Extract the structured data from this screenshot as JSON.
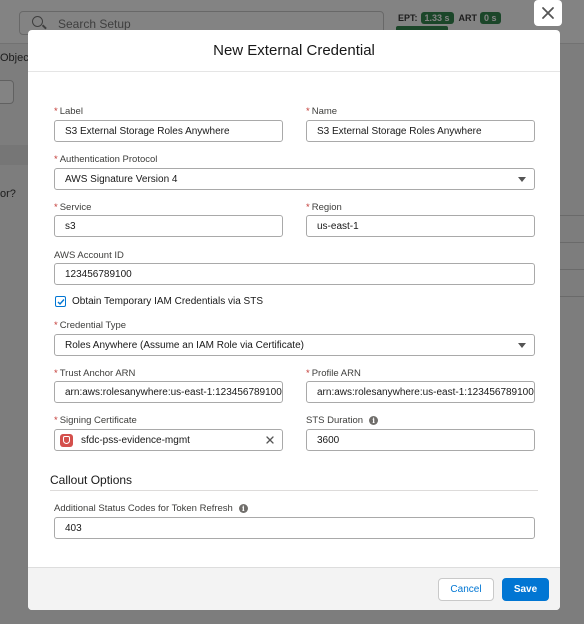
{
  "background": {
    "search_placeholder": "Search Setup",
    "ept_label": "EPT:",
    "ept_value": "1.33 s",
    "art_label": "ART",
    "art_value": "0 s",
    "objects_fragment": "Object",
    "or_fragment": "or?"
  },
  "modal": {
    "title": "New External Credential",
    "fields": {
      "label": {
        "label": "Label",
        "value": "S3 External Storage Roles Anywhere"
      },
      "name": {
        "label": "Name",
        "value": "S3 External Storage Roles Anywhere"
      },
      "auth_protocol": {
        "label": "Authentication Protocol",
        "value": "AWS Signature Version 4"
      },
      "service": {
        "label": "Service",
        "value": "s3"
      },
      "region": {
        "label": "Region",
        "value": "us-east-1"
      },
      "account_id": {
        "label": "AWS Account ID",
        "value": "123456789100"
      },
      "sts_checkbox": {
        "label": "Obtain Temporary IAM Credentials via STS",
        "checked": true
      },
      "credential_type": {
        "label": "Credential Type",
        "value": "Roles Anywhere (Assume an IAM Role via Certificate)"
      },
      "trust_anchor": {
        "label": "Trust Anchor ARN",
        "value": "arn:aws:rolesanywhere:us-east-1:123456789100"
      },
      "profile_arn": {
        "label": "Profile ARN",
        "value": "arn:aws:rolesanywhere:us-east-1:123456789100"
      },
      "signing_cert": {
        "label": "Signing Certificate",
        "value": "sfdc-pss-evidence-mgmt"
      },
      "sts_duration": {
        "label": "STS Duration",
        "value": "3600"
      }
    },
    "callout_section": {
      "title": "Callout Options",
      "status_codes": {
        "label": "Additional Status Codes for Token Refresh",
        "value": "403"
      }
    },
    "footer": {
      "cancel_label": "Cancel",
      "save_label": "Save"
    }
  },
  "colors": {
    "brand": "#0176d3",
    "required": "#c23934",
    "badge_green": "#2e844a"
  }
}
